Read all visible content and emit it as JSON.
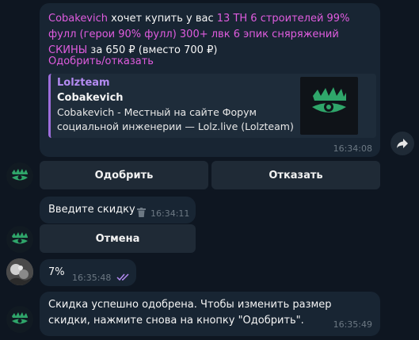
{
  "msg1": {
    "seller": "Cobakevich",
    "t1": " хочет купить у вас ",
    "tags": "13 ТН  6 строителей  99% фулл (герои 90% фулл) 300+ лвк  6 эпик сняряжений  СКИНЫ",
    "t2": " за 650 ₽ (вместо 700 ₽)",
    "action_link": "Одобрить/отказать",
    "preview": {
      "site": "Lolzteam",
      "title": "Cobakevich",
      "desc": "Cobakevich - Местный на сайте Форум социальной инженерии —  Lolz.live (Lolzteam)"
    },
    "time": "16:34:08"
  },
  "buttons1": {
    "approve": "Одобрить",
    "decline": "Отказать"
  },
  "msg2": {
    "text": "Введите скидку",
    "time": "16:34:11"
  },
  "buttons2": {
    "cancel": "Отмена"
  },
  "msg3": {
    "text": "7%",
    "time": "16:35:48"
  },
  "msg4": {
    "text": "Скидка успешно одобрена. Чтобы изменить размер скидки, нажмите снова на кнопку \"Одобрить\".",
    "time": "16:35:49"
  },
  "icons": {
    "forward": "share-arrow-icon",
    "delete": "trash-icon",
    "read": "double-check-icon",
    "bot_avatar": "lolz-logo-icon"
  },
  "colors": {
    "bg": "#0e1621",
    "bubble": "#182533",
    "accent_pink": "#e05cdf",
    "link_purple": "#b48bf2",
    "quote_bar": "#9d6ddb",
    "logo_green": "#2fa66a"
  }
}
